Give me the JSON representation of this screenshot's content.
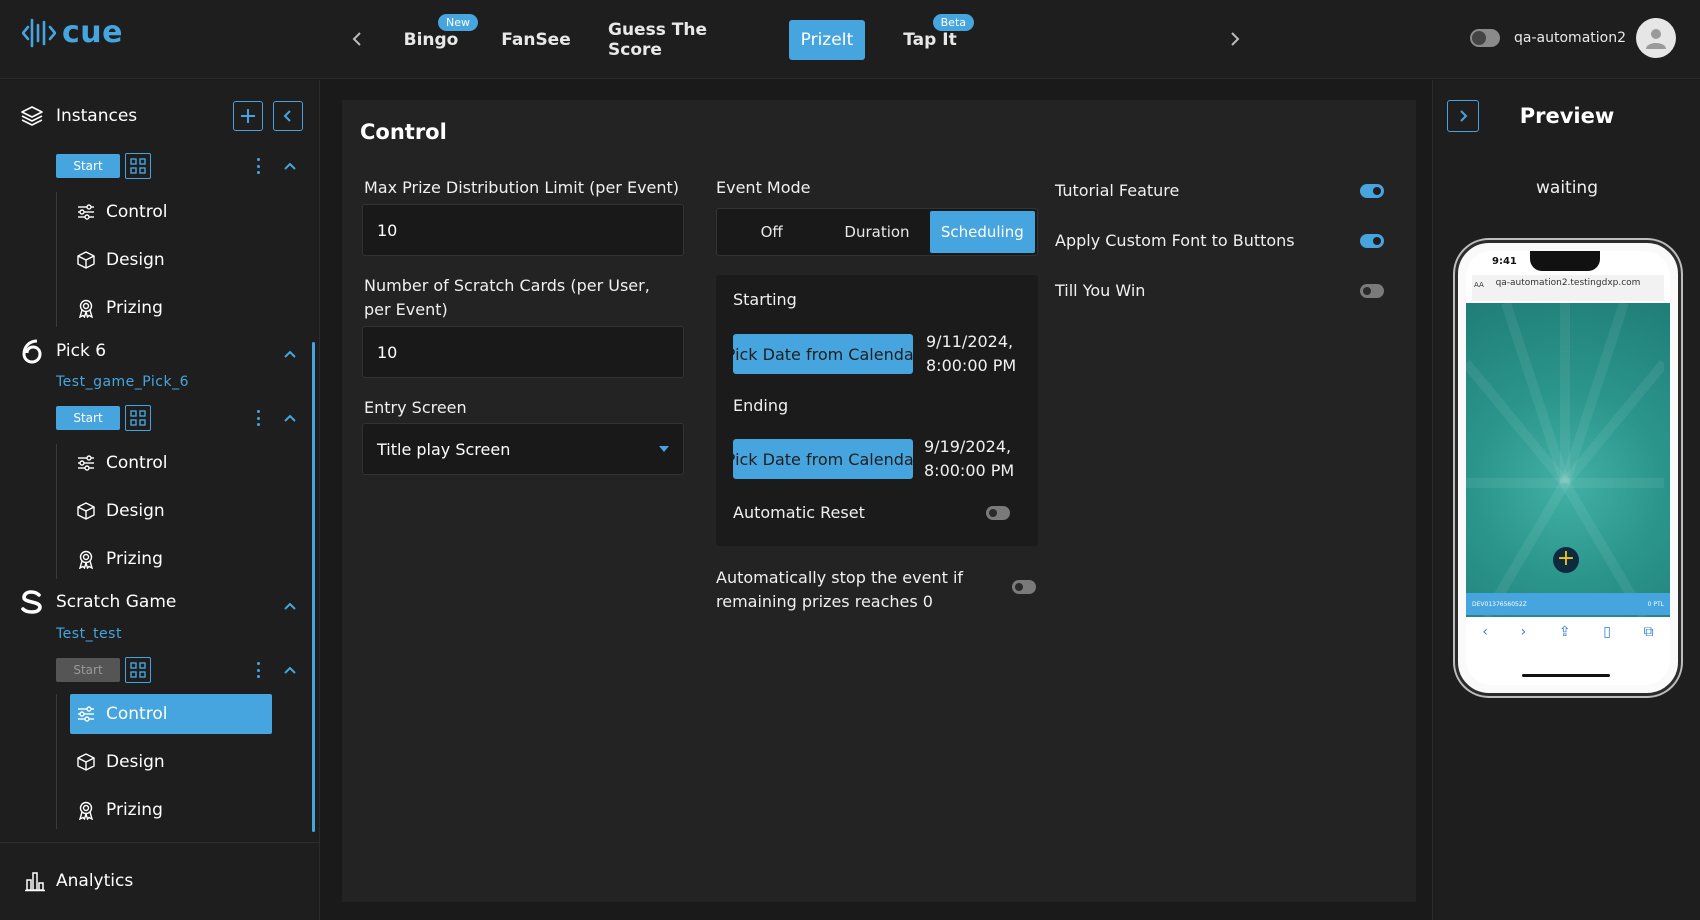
{
  "app": {
    "logo_text": "cue"
  },
  "nav": {
    "tabs": [
      {
        "label": "Bingo",
        "badge": "New"
      },
      {
        "label": "FanSee"
      },
      {
        "label": "Guess The Score"
      },
      {
        "label": "PrizeIt",
        "active": true
      },
      {
        "label": "Tap It",
        "badge": "Beta"
      }
    ]
  },
  "user": {
    "name": "qa-automation2"
  },
  "sidebar": {
    "instances_label": "Instances",
    "groups": [
      {
        "title": "",
        "subtitle": "",
        "start_label": "Start",
        "items": [
          "Control",
          "Design",
          "Prizing"
        ]
      },
      {
        "title": "Pick 6",
        "subtitle": "Test_game_Pick_6",
        "start_label": "Start",
        "items": [
          "Control",
          "Design",
          "Prizing"
        ]
      },
      {
        "title": "Scratch Game",
        "subtitle": "Test_test",
        "start_label": "Start",
        "items": [
          "Control",
          "Design",
          "Prizing"
        ],
        "active_item": "Control"
      }
    ],
    "analytics_label": "Analytics"
  },
  "control": {
    "title": "Control",
    "max_prize_label": "Max Prize Distribution Limit (per Event)",
    "max_prize_value": "10",
    "scratch_cards_label": "Number of Scratch Cards (per User, per Event)",
    "scratch_cards_value": "10",
    "entry_screen_label": "Entry Screen",
    "entry_screen_value": "Title play Screen",
    "event_mode_label": "Event Mode",
    "event_mode_options": [
      "Off",
      "Duration",
      "Scheduling"
    ],
    "event_mode_selected": "Scheduling",
    "starting_label": "Starting",
    "starting_button": "Pick Date from Calendar",
    "starting_date": "9/11/2024,",
    "starting_time": "8:00:00 PM",
    "ending_label": "Ending",
    "ending_button": "Pick Date from Calendar",
    "ending_date": "9/19/2024,",
    "ending_time": "8:00:00 PM",
    "auto_reset_label": "Automatic Reset",
    "auto_reset": false,
    "auto_stop_label": "Automatically stop the event if remaining prizes reaches 0",
    "auto_stop": false,
    "tutorial_label": "Tutorial Feature",
    "tutorial": true,
    "custom_font_label": "Apply Custom Font to Buttons",
    "custom_font": true,
    "till_you_win_label": "Till You Win",
    "till_you_win": false
  },
  "preview": {
    "title": "Preview",
    "status": "waiting",
    "phone_time": "9:41",
    "phone_aa": "AA",
    "phone_url": "qa-automation2.testingdxp.com",
    "phone_bar_left": "DEV0137656052Z",
    "phone_bar_right": "0 PTL"
  },
  "colors": {
    "accent": "#46a5de",
    "background": "#1a1a1a",
    "panel": "#232323"
  }
}
